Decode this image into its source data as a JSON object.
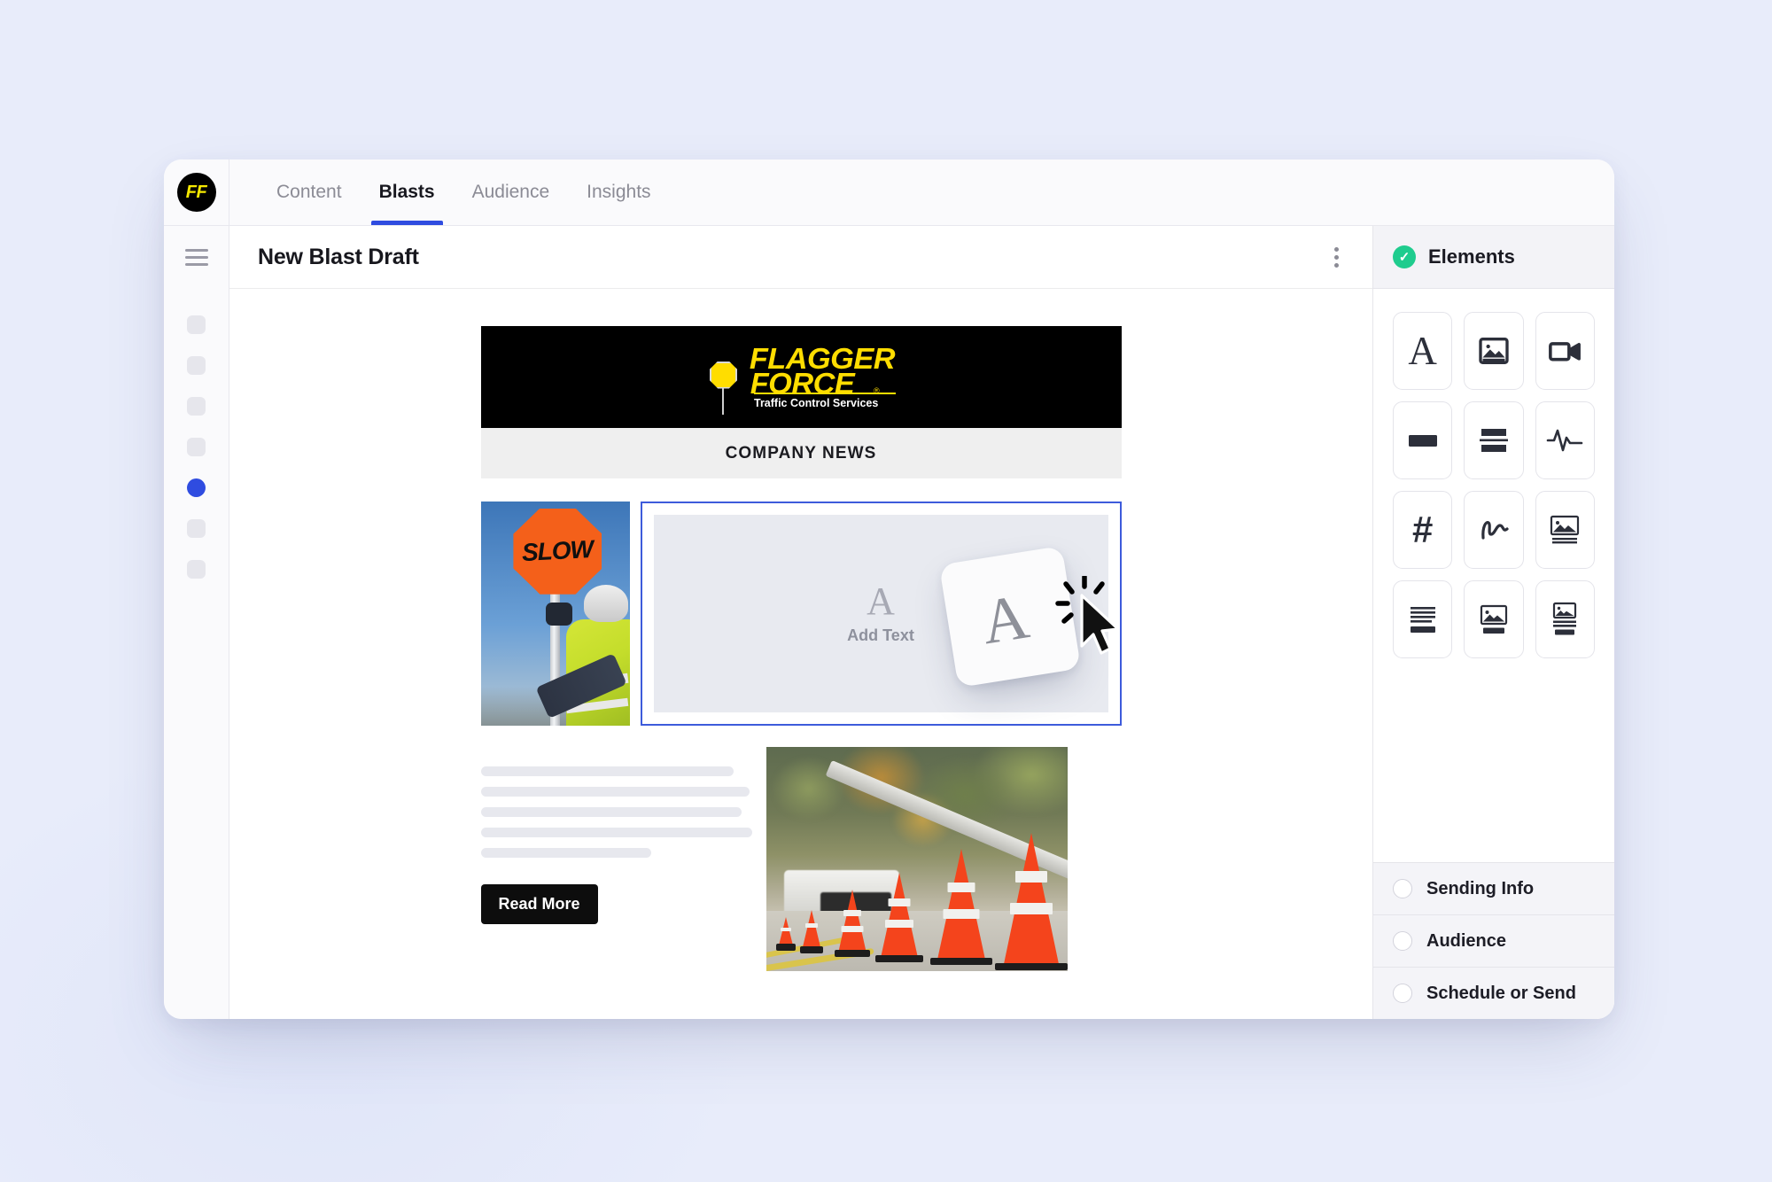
{
  "app": {
    "brand_logo_text": "FF",
    "tabs": [
      {
        "label": "Content",
        "active": false
      },
      {
        "label": "Blasts",
        "active": true
      },
      {
        "label": "Audience",
        "active": false
      },
      {
        "label": "Insights",
        "active": false
      }
    ],
    "accent_color": "#2f4ce0",
    "background_color": "#e8ecfa"
  },
  "editor": {
    "title": "New Blast Draft",
    "more_menu_icon": "kebab-menu-icon",
    "sidebar_toggle_icon": "hamburger-icon",
    "rail_items": [
      {
        "state": "inactive"
      },
      {
        "state": "inactive"
      },
      {
        "state": "inactive"
      },
      {
        "state": "inactive"
      },
      {
        "state": "active"
      },
      {
        "state": "inactive"
      },
      {
        "state": "inactive"
      }
    ]
  },
  "email": {
    "banner": {
      "brand_line_1": "FLAGGER",
      "brand_line_2": "FORCE",
      "registered_mark": "®",
      "tagline": "Traffic Control Services",
      "background_color": "#000000",
      "brand_color": "#ffdd00"
    },
    "section_heading": "COMPANY NEWS",
    "photo_1_alt": "flagger-holding-slow-sign-photo",
    "photo_1_sign_text": "SLOW",
    "photo_2_alt": "traffic-cones-on-road-photo",
    "drop_slot": {
      "icon": "A",
      "label": "Add Text",
      "selected": true,
      "selection_color": "#3d5bdb"
    },
    "body_skeleton_widths": [
      "92%",
      "98%",
      "95%",
      "99%",
      "62%"
    ],
    "cta_label": "Read More"
  },
  "drag": {
    "card_icon": "A",
    "cursor_icon": "click-cursor-icon"
  },
  "elements_panel": {
    "header_title": "Elements",
    "header_status_icon": "check-circle-icon",
    "header_status_color": "#1fcc8e",
    "grid": [
      {
        "icon": "text-icon",
        "label": "Text"
      },
      {
        "icon": "image-icon",
        "label": "Image"
      },
      {
        "icon": "video-icon",
        "label": "Video"
      },
      {
        "icon": "button-icon",
        "label": "Button"
      },
      {
        "icon": "divider-icon",
        "label": "Divider"
      },
      {
        "icon": "pulse-icon",
        "label": "Activity"
      },
      {
        "icon": "hashtag-icon",
        "label": "Social"
      },
      {
        "icon": "signature-icon",
        "label": "Signature"
      },
      {
        "icon": "image-caption-icon",
        "label": "Image with caption"
      },
      {
        "icon": "text-button-icon",
        "label": "Text with button"
      },
      {
        "icon": "image-button-icon",
        "label": "Image with button"
      },
      {
        "icon": "image-text-button-icon",
        "label": "Image, text and button"
      }
    ],
    "steps": [
      {
        "label": "Sending Info",
        "completed": false
      },
      {
        "label": "Audience",
        "completed": false
      },
      {
        "label": "Schedule or Send",
        "completed": false
      }
    ]
  }
}
